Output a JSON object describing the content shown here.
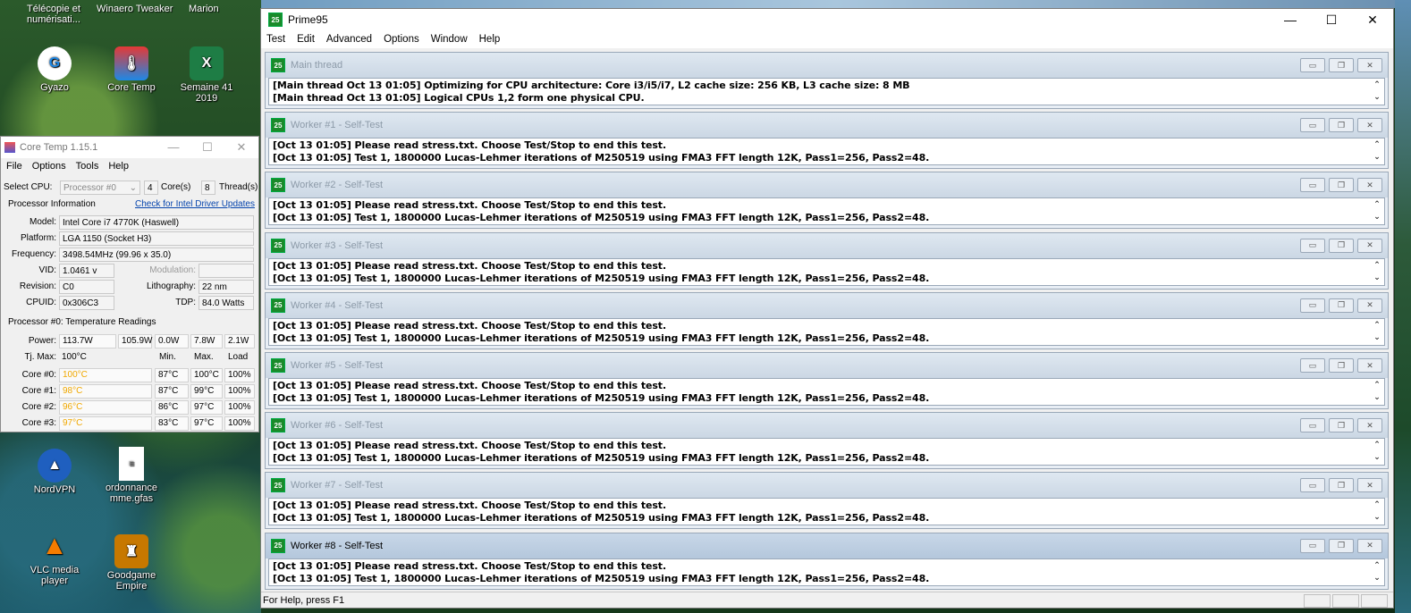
{
  "desktop": {
    "top_labels": [
      "Télécopie et numérisati...",
      "Winaero Tweaker",
      "Marion"
    ],
    "icons": [
      {
        "label": "Gyazo",
        "icon": "gyazo-icon"
      },
      {
        "label": "Core Temp",
        "icon": "coretemp-icon"
      },
      {
        "label": "Semaine 41 2019",
        "icon": "excel-icon"
      },
      {
        "label": "NordVPN",
        "icon": "nordvpn-icon"
      },
      {
        "label": "ordonnance mme.gfas",
        "icon": "document-icon"
      },
      {
        "label": "VLC media player",
        "icon": "vlc-icon"
      },
      {
        "label": "Goodgame Empire",
        "icon": "goodgame-icon"
      }
    ]
  },
  "coretemp": {
    "title": "Core Temp 1.15.1",
    "menu": [
      "File",
      "Options",
      "Tools",
      "Help"
    ],
    "select_cpu_label": "Select CPU:",
    "select_cpu_value": "Processor #0",
    "cores_value": "4",
    "cores_label": "Core(s)",
    "threads_value": "8",
    "threads_label": "Thread(s)",
    "processor_info_label": "Processor Information",
    "driver_link": "Check for Intel Driver Updates",
    "model_label": "Model:",
    "model_value": "Intel Core i7 4770K (Haswell)",
    "platform_label": "Platform:",
    "platform_value": "LGA 1150 (Socket H3)",
    "frequency_label": "Frequency:",
    "frequency_value": "3498.54MHz (99.96 x 35.0)",
    "vid_label": "VID:",
    "vid_value": "1.0461 v",
    "modulation_label": "Modulation:",
    "revision_label": "Revision:",
    "revision_value": "C0",
    "lithography_label": "Lithography:",
    "lithography_value": "22 nm",
    "cpuid_label": "CPUID:",
    "cpuid_value": "0x306C3",
    "tdp_label": "TDP:",
    "tdp_value": "84.0 Watts",
    "temps_header": "Processor #0: Temperature Readings",
    "power_label": "Power:",
    "power_values": [
      "113.7W",
      "105.9W",
      "0.0W",
      "7.8W",
      "2.1W"
    ],
    "tjmax_label": "Tj. Max:",
    "tjmax_value": "100°C",
    "col_min": "Min.",
    "col_max": "Max.",
    "col_load": "Load",
    "cores": [
      {
        "label": "Core #0:",
        "temp": "100°C",
        "min": "87°C",
        "max": "100°C",
        "load": "100%"
      },
      {
        "label": "Core #1:",
        "temp": "98°C",
        "min": "87°C",
        "max": "99°C",
        "load": "100%"
      },
      {
        "label": "Core #2:",
        "temp": "96°C",
        "min": "86°C",
        "max": "97°C",
        "load": "100%"
      },
      {
        "label": "Core #3:",
        "temp": "97°C",
        "min": "83°C",
        "max": "97°C",
        "load": "100%"
      }
    ]
  },
  "prime95": {
    "title": "Prime95",
    "menu": [
      "Test",
      "Edit",
      "Advanced",
      "Options",
      "Window",
      "Help"
    ],
    "status": "For Help, press F1",
    "windows": [
      {
        "title": "Main thread",
        "lines": [
          "[Main thread Oct 13 01:05] Optimizing for CPU architecture: Core i3/i5/i7, L2 cache size: 256 KB, L3 cache size: 8 MB",
          "[Main thread Oct 13 01:05] Logical CPUs 1,2 form one physical CPU."
        ]
      },
      {
        "title": "Worker #1 - Self-Test",
        "lines": [
          "[Oct 13 01:05] Please read stress.txt.  Choose Test/Stop to end this test.",
          "[Oct 13 01:05] Test 1, 1800000 Lucas-Lehmer iterations of M250519 using FMA3 FFT length 12K, Pass1=256, Pass2=48."
        ]
      },
      {
        "title": "Worker #2 - Self-Test",
        "lines": [
          "[Oct 13 01:05] Please read stress.txt.  Choose Test/Stop to end this test.",
          "[Oct 13 01:05] Test 1, 1800000 Lucas-Lehmer iterations of M250519 using FMA3 FFT length 12K, Pass1=256, Pass2=48."
        ]
      },
      {
        "title": "Worker #3 - Self-Test",
        "lines": [
          "[Oct 13 01:05] Please read stress.txt.  Choose Test/Stop to end this test.",
          "[Oct 13 01:05] Test 1, 1800000 Lucas-Lehmer iterations of M250519 using FMA3 FFT length 12K, Pass1=256, Pass2=48."
        ]
      },
      {
        "title": "Worker #4 - Self-Test",
        "lines": [
          "[Oct 13 01:05] Please read stress.txt.  Choose Test/Stop to end this test.",
          "[Oct 13 01:05] Test 1, 1800000 Lucas-Lehmer iterations of M250519 using FMA3 FFT length 12K, Pass1=256, Pass2=48."
        ]
      },
      {
        "title": "Worker #5 - Self-Test",
        "lines": [
          "[Oct 13 01:05] Please read stress.txt.  Choose Test/Stop to end this test.",
          "[Oct 13 01:05] Test 1, 1800000 Lucas-Lehmer iterations of M250519 using FMA3 FFT length 12K, Pass1=256, Pass2=48."
        ]
      },
      {
        "title": "Worker #6 - Self-Test",
        "lines": [
          "[Oct 13 01:05] Please read stress.txt.  Choose Test/Stop to end this test.",
          "[Oct 13 01:05] Test 1, 1800000 Lucas-Lehmer iterations of M250519 using FMA3 FFT length 12K, Pass1=256, Pass2=48."
        ]
      },
      {
        "title": "Worker #7 - Self-Test",
        "lines": [
          "[Oct 13 01:05] Please read stress.txt.  Choose Test/Stop to end this test.",
          "[Oct 13 01:05] Test 1, 1800000 Lucas-Lehmer iterations of M250519 using FMA3 FFT length 12K, Pass1=256, Pass2=48."
        ]
      },
      {
        "title": "Worker #8 - Self-Test",
        "lines": [
          "[Oct 13 01:05] Please read stress.txt.  Choose Test/Stop to end this test.",
          "[Oct 13 01:05] Test 1, 1800000 Lucas-Lehmer iterations of M250519 using FMA3 FFT length 12K, Pass1=256, Pass2=48."
        ]
      }
    ]
  }
}
